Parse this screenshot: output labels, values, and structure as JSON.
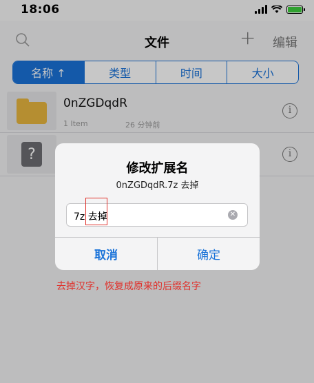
{
  "status_bar": {
    "time": "18:06"
  },
  "nav": {
    "title": "文件",
    "plus_glyph": "+",
    "edit_label": "编辑"
  },
  "sort_tabs": [
    {
      "label": "名称 ↑",
      "active": true
    },
    {
      "label": "类型",
      "active": false
    },
    {
      "label": "时间",
      "active": false
    },
    {
      "label": "大小",
      "active": false
    }
  ],
  "files": [
    {
      "name": "0nZGDqdR",
      "meta": "1 Item",
      "time": "26 分钟前",
      "icon": "folder-icon"
    },
    {
      "name": "",
      "meta": "",
      "time": "",
      "icon": "unknown-file-icon"
    }
  ],
  "dialog": {
    "title": "修改扩展名",
    "subtitle": "0nZGDqdR.7z 去掉",
    "input_value": "7z 去掉",
    "cancel_label": "取消",
    "ok_label": "确定"
  },
  "annotation": "去掉汉字，恢复成原来的后缀名字",
  "colors": {
    "accent": "#1a73d9",
    "annotation": "#e0302a",
    "folder": "#e8b63f"
  }
}
